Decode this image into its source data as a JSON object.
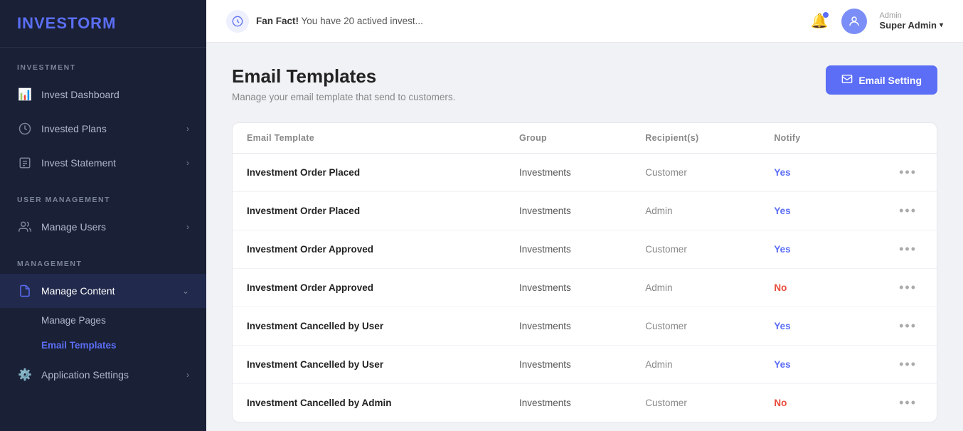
{
  "brand": {
    "name_part1": "INVEST",
    "name_part2": "ORM"
  },
  "topbar": {
    "fan_fact_label": "Fan Fact!",
    "fan_fact_text": "You have 20 actived invest...",
    "admin_label": "Admin",
    "username": "Super Admin",
    "bell_icon": "🔔"
  },
  "sidebar": {
    "investment_section": "INVESTMENT",
    "items": [
      {
        "id": "invest-dashboard",
        "label": "Invest Dashboard",
        "icon": "📊",
        "active": false,
        "has_sub": false
      },
      {
        "id": "invested-plans",
        "label": "Invested Plans",
        "icon": "💼",
        "active": false,
        "has_sub": true
      },
      {
        "id": "invest-statement",
        "label": "Invest Statement",
        "icon": "📋",
        "active": false,
        "has_sub": true
      }
    ],
    "user_management_section": "USER MANAGEMENT",
    "user_items": [
      {
        "id": "manage-users",
        "label": "Manage Users",
        "icon": "👥",
        "active": false,
        "has_sub": true
      }
    ],
    "management_section": "MANAGEMENT",
    "management_items": [
      {
        "id": "manage-content",
        "label": "Manage Content",
        "icon": "📄",
        "active": true,
        "has_sub": true
      }
    ],
    "manage_content_sub": [
      {
        "id": "manage-pages",
        "label": "Manage Pages",
        "active": false
      },
      {
        "id": "email-templates",
        "label": "Email Templates",
        "active": true
      }
    ],
    "settings_items": [
      {
        "id": "application-settings",
        "label": "Application Settings",
        "icon": "⚙️",
        "active": false,
        "has_sub": true
      }
    ]
  },
  "page": {
    "title": "Email Templates",
    "subtitle": "Manage your email template that send to customers.",
    "email_setting_btn": "Email Setting"
  },
  "table": {
    "columns": [
      "Email Template",
      "Group",
      "Recipient(s)",
      "Notify"
    ],
    "rows": [
      {
        "template": "Investment Order Placed",
        "group": "Investments",
        "recipient": "Customer",
        "notify": "Yes",
        "notify_status": "yes"
      },
      {
        "template": "Investment Order Placed",
        "group": "Investments",
        "recipient": "Admin",
        "notify": "Yes",
        "notify_status": "yes"
      },
      {
        "template": "Investment Order Approved",
        "group": "Investments",
        "recipient": "Customer",
        "notify": "Yes",
        "notify_status": "yes"
      },
      {
        "template": "Investment Order Approved",
        "group": "Investments",
        "recipient": "Admin",
        "notify": "No",
        "notify_status": "no"
      },
      {
        "template": "Investment Cancelled by User",
        "group": "Investments",
        "recipient": "Customer",
        "notify": "Yes",
        "notify_status": "yes"
      },
      {
        "template": "Investment Cancelled by User",
        "group": "Investments",
        "recipient": "Admin",
        "notify": "Yes",
        "notify_status": "yes"
      },
      {
        "template": "Investment Cancelled by Admin",
        "group": "Investments",
        "recipient": "Customer",
        "notify": "No",
        "notify_status": "no"
      }
    ]
  }
}
